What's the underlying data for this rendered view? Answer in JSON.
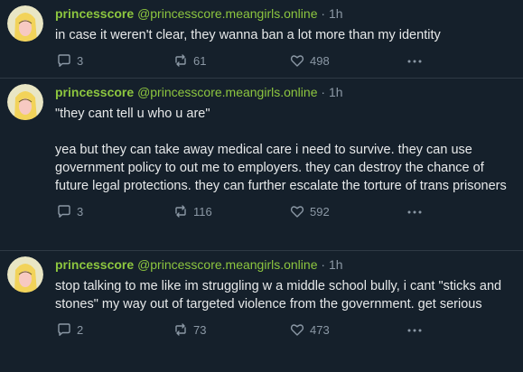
{
  "colors": {
    "background": "#15202b",
    "accent": "#8dc63f",
    "muted": "#8b98a5",
    "text": "#e7e9ea"
  },
  "icons": {
    "reply": "reply-icon",
    "repost": "repost-icon",
    "like": "heart-icon",
    "more": "more-icon"
  },
  "posts": [
    {
      "name": "princesscore",
      "handle": "@princesscore.meangirls.online",
      "separator": "·",
      "time": "1h",
      "text": "in case it weren't clear, they wanna ban a lot more than my identity",
      "replies": "3",
      "reposts": "61",
      "likes": "498"
    },
    {
      "name": "princesscore",
      "handle": "@princesscore.meangirls.online",
      "separator": "·",
      "time": "1h",
      "text": "\"they cant tell u who u are\"\n\nyea but they can take away medical care i need to survive. they can use government policy to out me to employers. they can destroy the chance of future legal protections. they can further escalate the torture of trans prisoners",
      "replies": "3",
      "reposts": "116",
      "likes": "592"
    },
    {
      "name": "princesscore",
      "handle": "@princesscore.meangirls.online",
      "separator": "·",
      "time": "1h",
      "text": "stop talking to me like im struggling w a middle school bully, i cant \"sticks and stones\" my way out of targeted violence from the government. get serious",
      "replies": "2",
      "reposts": "73",
      "likes": "473"
    }
  ]
}
